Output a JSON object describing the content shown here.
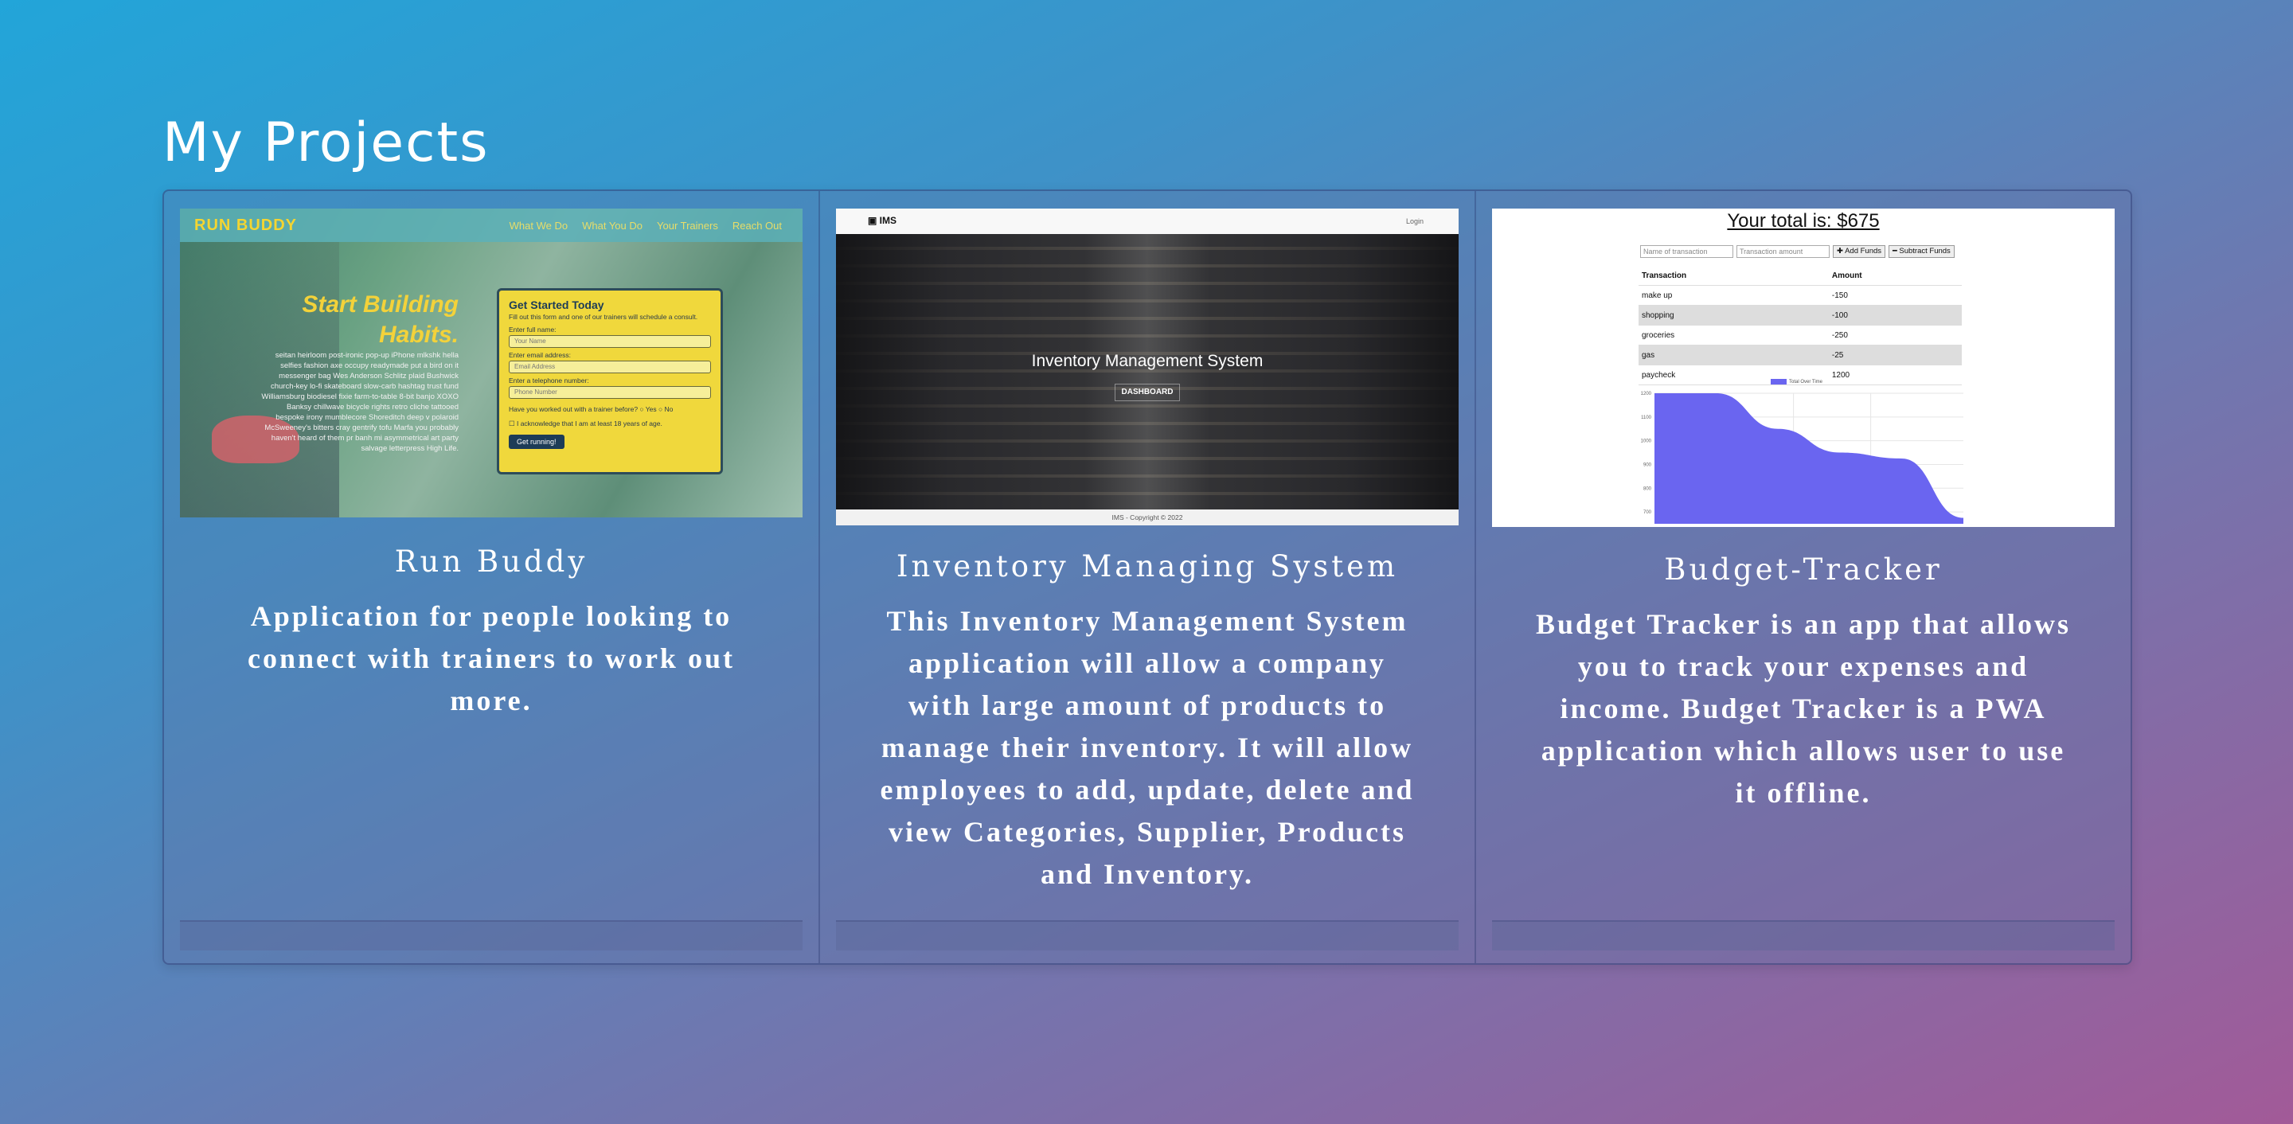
{
  "page": {
    "title": "My Projects"
  },
  "projects": [
    {
      "title": "Run Buddy",
      "description": "Application for people looking to connect with trainers to work out more.",
      "thumbnail": {
        "logo": "RUN BUDDY",
        "nav": [
          "What We Do",
          "What You Do",
          "Your Trainers",
          "Reach Out"
        ],
        "hero_title_line1": "Start Building",
        "hero_title_line2": "Habits.",
        "hero_text": "seitan heirloom post-ironic pop-up iPhone mlkshk hella selfies fashion axe occupy readymade put a bird on it messenger bag Wes Anderson Schlitz plaid Bushwick church-key lo-fi skateboard slow-carb hashtag trust fund Williamsburg biodiesel fixie farm-to-table 8-bit banjo XOXO Banksy chillwave bicycle rights retro cliche tattooed bespoke irony mumblecore Shoreditch deep v polaroid McSweeney's bitters cray gentrify tofu Marfa you probably haven't heard of them pr banh mi asymmetrical art party salvage letterpress High Life.",
        "form_title": "Get Started Today",
        "form_subtitle": "Fill out this form and one of our trainers will schedule a consult.",
        "name_label": "Enter full name:",
        "name_placeholder": "Your Name",
        "email_label": "Enter email address:",
        "email_placeholder": "Email Address",
        "phone_label": "Enter a telephone number:",
        "phone_placeholder": "Phone Number",
        "question": "Have you worked out with a trainer before?",
        "yes": "Yes",
        "no": "No",
        "ack": "I acknowledge that I am at least 18 years of age.",
        "button": "Get running!"
      }
    },
    {
      "title": "Inventory Managing System",
      "description": "This Inventory Management System application will allow a company with large amount of products to manage their inventory. It will allow employees to add, update, delete and view Categories, Supplier, Products and Inventory.",
      "thumbnail": {
        "brand": "IMS",
        "login": "Login",
        "hero_title": "Inventory Management System",
        "hero_button": "DASHBOARD",
        "footer": "IMS - Copyright © 2022"
      }
    },
    {
      "title": "Budget-Tracker",
      "description": "Budget Tracker is an app that allows you to track your expenses and income. Budget Tracker is a PWA application which allows user to use it offline.",
      "thumbnail": {
        "total": "Your total is: $675",
        "name_placeholder": "Name of transaction",
        "amount_placeholder": "Transaction amount",
        "add_button": "✚ Add Funds",
        "subtract_button": "━ Subtract Funds",
        "col_transaction": "Transaction",
        "col_amount": "Amount",
        "rows": [
          {
            "name": "make up",
            "amount": "-150"
          },
          {
            "name": "shopping",
            "amount": "-100"
          },
          {
            "name": "groceries",
            "amount": "-250"
          },
          {
            "name": "gas",
            "amount": "-25"
          },
          {
            "name": "paycheck",
            "amount": "1200"
          }
        ],
        "legend": "Total Over Time",
        "y_ticks": [
          "1200",
          "1100",
          "1000",
          "900",
          "800",
          "700"
        ],
        "series_values": [
          1200,
          1200,
          1050,
          950,
          925,
          675
        ],
        "fill_color": "#6a65f0"
      }
    }
  ]
}
